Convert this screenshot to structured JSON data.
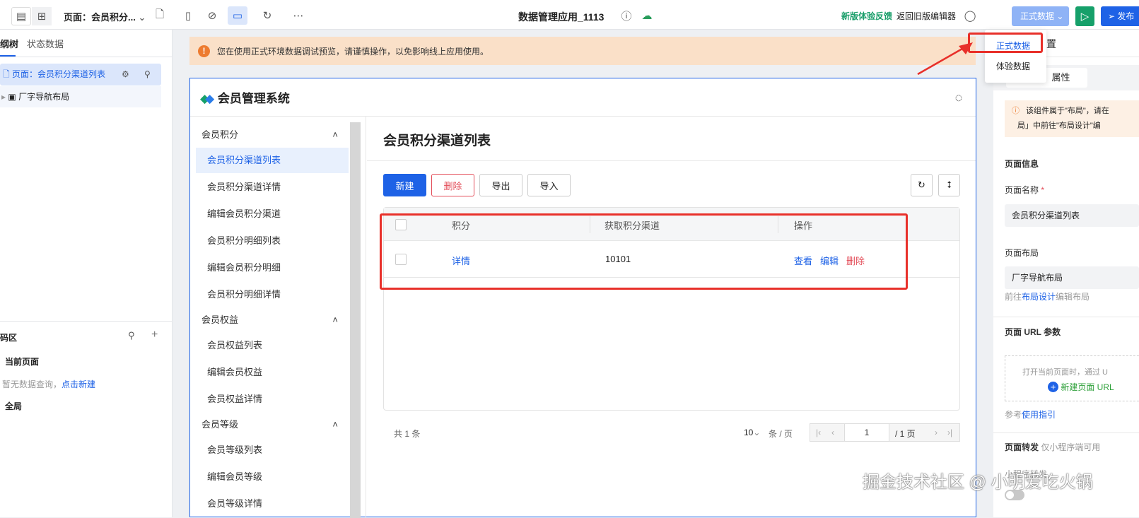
{
  "topbar": {
    "page_select": "页面：会员积分...",
    "app_title": "数据管理应用_1113",
    "feedback": "新版体验反馈",
    "back_old": "返回旧版编辑器",
    "env_select": "正式数据",
    "publish": "发布"
  },
  "env_dropdown": {
    "options": [
      "正式数据",
      "体验数据"
    ]
  },
  "left": {
    "tabs": [
      "纲树",
      "状态数据"
    ],
    "tree": [
      {
        "label": "页面：会员积分渠道列表"
      },
      {
        "label": "厂字导航布局"
      }
    ],
    "code_title": "码区",
    "current_page": "当前页面",
    "empty_text": "暂无数据查询，",
    "create_link": "点击新建",
    "global": "全局"
  },
  "banner": {
    "text": "您在使用正式环境数据调试预览，请谨慎操作，以免影响线上应用使用。"
  },
  "app": {
    "name": "会员管理系统",
    "nav": [
      {
        "group": "会员积分",
        "items": [
          "会员积分渠道列表",
          "会员积分渠道详情",
          "编辑会员积分渠道",
          "会员积分明细列表",
          "编辑会员积分明细",
          "会员积分明细详情"
        ]
      },
      {
        "group": "会员权益",
        "items": [
          "会员权益列表",
          "编辑会员权益",
          "会员权益详情"
        ]
      },
      {
        "group": "会员等级",
        "items": [
          "会员等级列表",
          "编辑会员等级",
          "会员等级详情"
        ]
      }
    ],
    "page_title": "会员积分渠道列表",
    "buttons": {
      "new": "新建",
      "delete": "删除",
      "export": "导出",
      "import": "导入"
    },
    "table": {
      "headers": [
        "积分",
        "获取积分渠道",
        "操作"
      ],
      "rows": [
        {
          "points": "详情",
          "channel": "10101",
          "actions": [
            "查看",
            "编辑",
            "删除"
          ]
        }
      ]
    },
    "pagination": {
      "total": "共 1 条",
      "page_size": "10",
      "per_page": "条 / 页",
      "current": "1",
      "pages": "/ 1 页"
    }
  },
  "right": {
    "tab": "置",
    "sub_tab": "属性",
    "notice1": "该组件属于\"布局\"，请在",
    "notice2": "局」中前往\"布局设计\"编",
    "section_info": "页面信息",
    "name_label": "页面名称",
    "name_value": "会员积分渠道列表",
    "layout_label": "页面布局",
    "layout_value": "厂字导航布局",
    "layout_hint_pre": "前往",
    "layout_hint_link": "布局设计",
    "layout_hint_post": "编辑布局",
    "url_title": "页面 URL 参数",
    "url_desc": "打开当前页面时，通过 U",
    "url_new": "新建页面 URL",
    "ref_pre": "参考",
    "ref_link": "使用指引",
    "forward_title": "页面转发",
    "forward_hint": "仅小程序端可用",
    "forward_label": "小程序转发"
  },
  "watermark": "掘金技术社区 @ 小明爱吃火锅"
}
